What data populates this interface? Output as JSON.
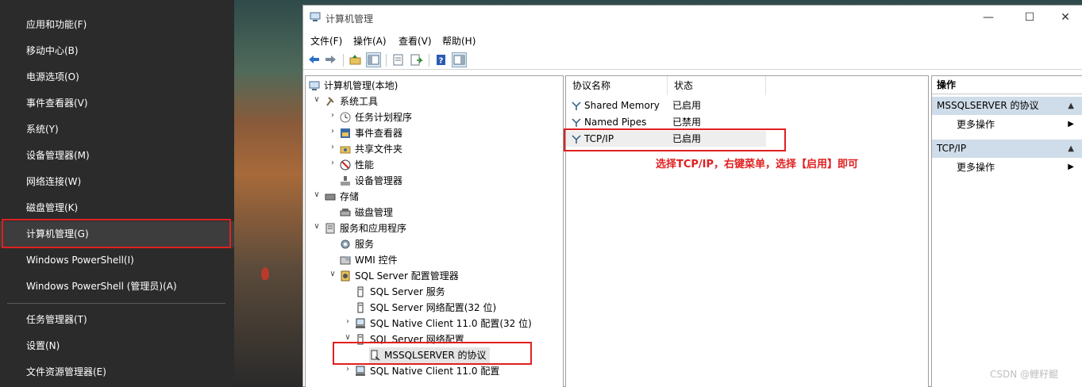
{
  "winx_menu": {
    "items": [
      {
        "label": "应用和功能(F)"
      },
      {
        "label": "移动中心(B)"
      },
      {
        "label": "电源选项(O)"
      },
      {
        "label": "事件查看器(V)"
      },
      {
        "label": "系统(Y)"
      },
      {
        "label": "设备管理器(M)"
      },
      {
        "label": "网络连接(W)"
      },
      {
        "label": "磁盘管理(K)"
      },
      {
        "label": "计算机管理(G)"
      },
      {
        "label": "Windows PowerShell(I)"
      },
      {
        "label": "Windows PowerShell (管理员)(A)"
      },
      {
        "label": "任务管理器(T)"
      },
      {
        "label": "设置(N)"
      },
      {
        "label": "文件资源管理器(E)"
      }
    ],
    "selected_index": 8
  },
  "window": {
    "title": "计算机管理",
    "controls": {
      "minimize": "—",
      "maximize": "☐",
      "close": "✕"
    }
  },
  "menubar": [
    "文件(F)",
    "操作(A)",
    "查看(V)",
    "帮助(H)"
  ],
  "toolbar": {
    "icons": [
      "back-arrow-icon",
      "forward-arrow-icon",
      "up-folder-icon",
      "show-hide-tree-icon",
      "properties-icon",
      "export-list-icon",
      "help-icon",
      "show-hide-action-pane-icon"
    ]
  },
  "tree": {
    "root": "计算机管理(本地)",
    "system_tools": "系统工具",
    "task_scheduler": "任务计划程序",
    "event_viewer": "事件查看器",
    "shared_folders": "共享文件夹",
    "performance": "性能",
    "device_manager": "设备管理器",
    "storage": "存储",
    "disk_management": "磁盘管理",
    "services_apps": "服务和应用程序",
    "services": "服务",
    "wmi": "WMI 控件",
    "sql_config": "SQL Server 配置管理器",
    "sql_services": "SQL Server 服务",
    "sql_net32": "SQL Server 网络配置(32 位)",
    "native_client32": "SQL Native Client 11.0 配置(32 位)",
    "sql_net": "SQL Server 网络配置",
    "mssql_protocols": "MSSQLSERVER 的协议",
    "native_client": "SQL Native Client 11.0 配置"
  },
  "list": {
    "headers": [
      "协议名称",
      "状态"
    ],
    "rows": [
      {
        "name": "Shared Memory",
        "status": "已启用"
      },
      {
        "name": "Named Pipes",
        "status": "已禁用"
      },
      {
        "name": "TCP/IP",
        "status": "已启用"
      }
    ]
  },
  "actions": {
    "header": "操作",
    "sections": [
      {
        "title": "MSSQLSERVER 的协议",
        "item": "更多操作"
      },
      {
        "title": "TCP/IP",
        "item": "更多操作"
      }
    ]
  },
  "annotation": "选择TCP/IP，右键菜单，选择【启用】即可",
  "watermark": "CSDN @鲤籽鲲",
  "colors": {
    "annotation_red": "#e02020",
    "menu_bg": "#2b2b2b",
    "action_section_bg": "#cfdce9"
  }
}
